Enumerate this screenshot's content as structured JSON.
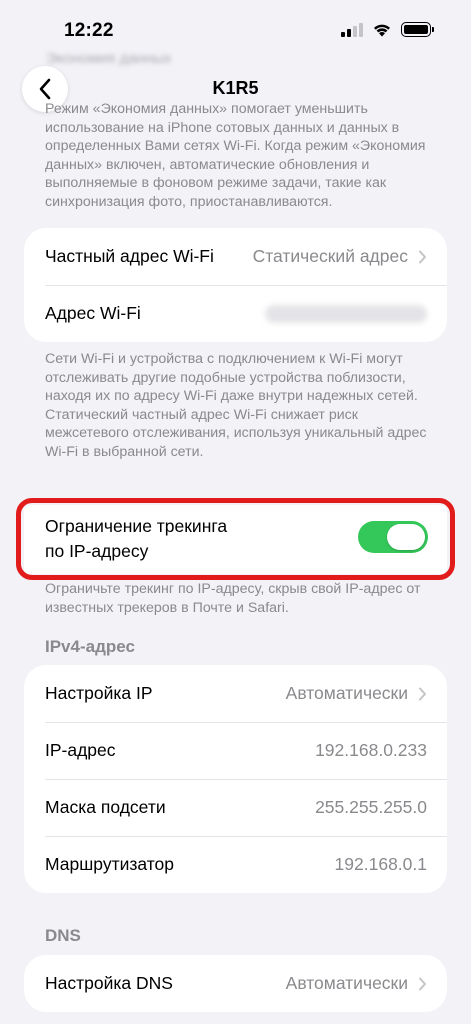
{
  "status_bar": {
    "time": "12:22"
  },
  "nav": {
    "title": "K1R5",
    "blurred_heading": "Экономия данных"
  },
  "data_saver_note": "Режим «Экономия данных» помогает уменьшить использование на iPhone сотовых данных и данных в определенных Вами сетях Wi-Fi. Когда режим «Экономия данных» включен, автоматические обновления и выполняемые в фоновом режиме задачи, такие как синхронизация фото, приостанавливаются.",
  "wifi_address_section": {
    "private_address_label": "Частный адрес Wi-Fi",
    "private_address_value": "Статический адрес",
    "wifi_address_label": "Адрес Wi-Fi",
    "note": "Сети Wi-Fi и устройства с подключением к Wi-Fi могут отслеживать другие подобные устройства поблизости, находя их по адресу Wi-Fi даже внутри надежных сетей. Статический частный адрес Wi-Fi снижает риск межсетевого отслеживания, используя уникальный адрес Wi-Fi в выбранной сети."
  },
  "ip_tracking": {
    "label_line1": "Ограничение трекинга",
    "label_line2": "по IP-адресу",
    "enabled": true,
    "note": "Ограничьте трекинг по IP-адресу, скрыв свой IP-адрес от известных трекеров в Почте и Safari."
  },
  "ipv4": {
    "header": "IPv4-адрес",
    "rows": [
      {
        "label": "Настройка IP",
        "value": "Автоматически"
      },
      {
        "label": "IP-адрес",
        "value": "192.168.0.233"
      },
      {
        "label": "Маска подсети",
        "value": "255.255.255.0"
      },
      {
        "label": "Маршрутизатор",
        "value": "192.168.0.1"
      }
    ]
  },
  "dns": {
    "header": "DNS",
    "config_label": "Настройка DNS",
    "config_value": "Автоматически"
  },
  "colors": {
    "toggle_on": "#34c759",
    "highlight": "#e21b1b",
    "background": "#f2f2f7"
  }
}
